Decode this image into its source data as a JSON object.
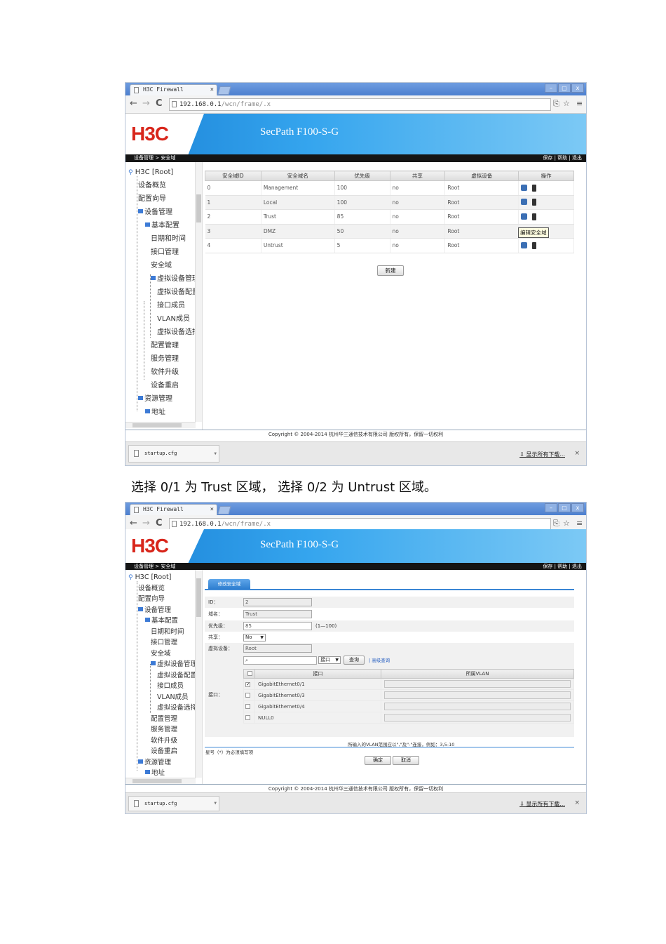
{
  "browser": {
    "tab_title": "H3C Firewall",
    "tab_close": "×",
    "url_host": "192.168.0.1",
    "url_path": "/wcn/frame/.x",
    "back": "←",
    "forward": "→",
    "reload": "C",
    "window_buttons": [
      "–",
      "▢",
      "x"
    ]
  },
  "header": {
    "logo": "H3C",
    "product": "SecPath F100-S-G"
  },
  "breadcrumb": {
    "path": "设备管理 > 安全域",
    "tools": "保存 | 帮助 | 退出"
  },
  "sidebar": {
    "root": "H3C [Root]",
    "items": [
      {
        "label": "设备概览"
      },
      {
        "label": "配置向导"
      },
      {
        "label": "设备管理"
      },
      {
        "label": "基本配置"
      },
      {
        "label": "日期和时间"
      },
      {
        "label": "接口管理"
      },
      {
        "label": "安全域"
      },
      {
        "label": "虚拟设备管理"
      },
      {
        "label": "虚拟设备配置"
      },
      {
        "label": "接口成员"
      },
      {
        "label": "VLAN成员"
      },
      {
        "label": "虚拟设备选择"
      },
      {
        "label": "配置管理"
      },
      {
        "label": "服务管理"
      },
      {
        "label": "软件升级"
      },
      {
        "label": "设备重启"
      },
      {
        "label": "资源管理"
      },
      {
        "label": "地址"
      }
    ]
  },
  "zone_table": {
    "headers": [
      "安全域ID",
      "安全域名",
      "优先级",
      "共享",
      "虚拟设备",
      "操作"
    ],
    "rows": [
      {
        "id": "0",
        "name": "Management",
        "priority": "100",
        "share": "no",
        "vdev": "Root"
      },
      {
        "id": "1",
        "name": "Local",
        "priority": "100",
        "share": "no",
        "vdev": "Root"
      },
      {
        "id": "2",
        "name": "Trust",
        "priority": "85",
        "share": "no",
        "vdev": "Root"
      },
      {
        "id": "3",
        "name": "DMZ",
        "priority": "50",
        "share": "no",
        "vdev": "Root"
      },
      {
        "id": "4",
        "name": "Untrust",
        "priority": "5",
        "share": "no",
        "vdev": "Root"
      }
    ],
    "tooltip": "编辑安全域",
    "new_button": "新建"
  },
  "footer": {
    "copyright": "Copyright © 2004-2014 杭州华三通信技术有限公司 版权所有，保留一切权利"
  },
  "download_bar": {
    "file": "startup.cfg",
    "show_all": "显示所有下载...",
    "close": "×"
  },
  "caption": "选择  0/1 为 Trust 区域， 选择  0/2 为 Untrust 区域。",
  "edit_form": {
    "tab": "修改安全域",
    "id_label": "ID：",
    "id_value": "2",
    "name_label": "域名：",
    "name_value": "Trust",
    "priority_label": "优先级：",
    "priority_value": "85",
    "priority_hint": "(1—100)",
    "share_label": "共享：",
    "share_value": "No",
    "vdev_label": "虚拟设备：",
    "vdev_value": "Root",
    "interface_label": "接口：",
    "search_field_select": "接口",
    "query_button": "查询",
    "advanced_query": "高级查询",
    "iface_headers": [
      "接口",
      "所属VLAN"
    ],
    "interfaces": [
      {
        "name": "GigabitEthernet0/1",
        "checked": "✓"
      },
      {
        "name": "GigabitEthernet0/3",
        "checked": ""
      },
      {
        "name": "GigabitEthernet0/4",
        "checked": ""
      },
      {
        "name": "NULL0",
        "checked": ""
      }
    ],
    "vlan_note": "所输入的VLAN范围应以\",\"及\"-\"连接，例如：3,5-10",
    "required_note": "星号（*）为必须填写项",
    "ok_button": "确定",
    "cancel_button": "取消"
  },
  "colors": {
    "banner_blue": "#1c84d8",
    "logo_red": "#d8261b",
    "tab_blue": "#2f7fd0"
  }
}
